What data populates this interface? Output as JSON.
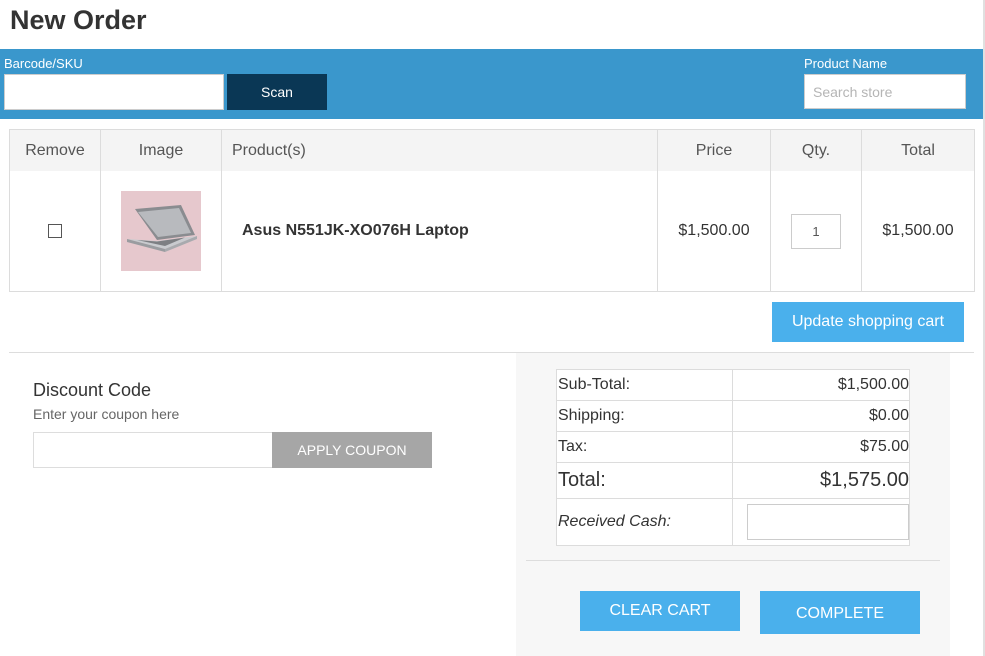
{
  "page": {
    "title": "New Order"
  },
  "scan_bar": {
    "barcode_label": "Barcode/SKU",
    "barcode_value": "",
    "scan_label": "Scan",
    "product_name_label": "Product Name",
    "search_placeholder": "Search store"
  },
  "cart": {
    "headers": {
      "remove": "Remove",
      "image": "Image",
      "product": "Product(s)",
      "price": "Price",
      "qty": "Qty.",
      "total": "Total"
    },
    "items": [
      {
        "name": "Asus N551JK-XO076H Laptop",
        "price": "$1,500.00",
        "qty": "1",
        "total": "$1,500.00",
        "image_icon": "laptop-icon",
        "selected": false
      }
    ],
    "update_label": "Update shopping cart"
  },
  "discount": {
    "title": "Discount Code",
    "hint": "Enter your coupon here",
    "code_value": "",
    "apply_label": "APPLY COUPON"
  },
  "totals": {
    "subtotal_label": "Sub-Total:",
    "subtotal_value": "$1,500.00",
    "shipping_label": "Shipping:",
    "shipping_value": "$0.00",
    "tax_label": "Tax:",
    "tax_value": "$75.00",
    "total_label": "Total:",
    "total_value": "$1,575.00",
    "cash_label": "Received Cash:",
    "cash_value": ""
  },
  "actions": {
    "clear_label": "CLEAR CART",
    "complete_label": "COMPLETE"
  },
  "colors": {
    "scan_bar": "#3a97cc",
    "scan_button": "#0a3755",
    "accent_button": "#4ab0ec",
    "apply_button": "#a6a6a6",
    "product_image_bg": "#e6c8cd"
  }
}
